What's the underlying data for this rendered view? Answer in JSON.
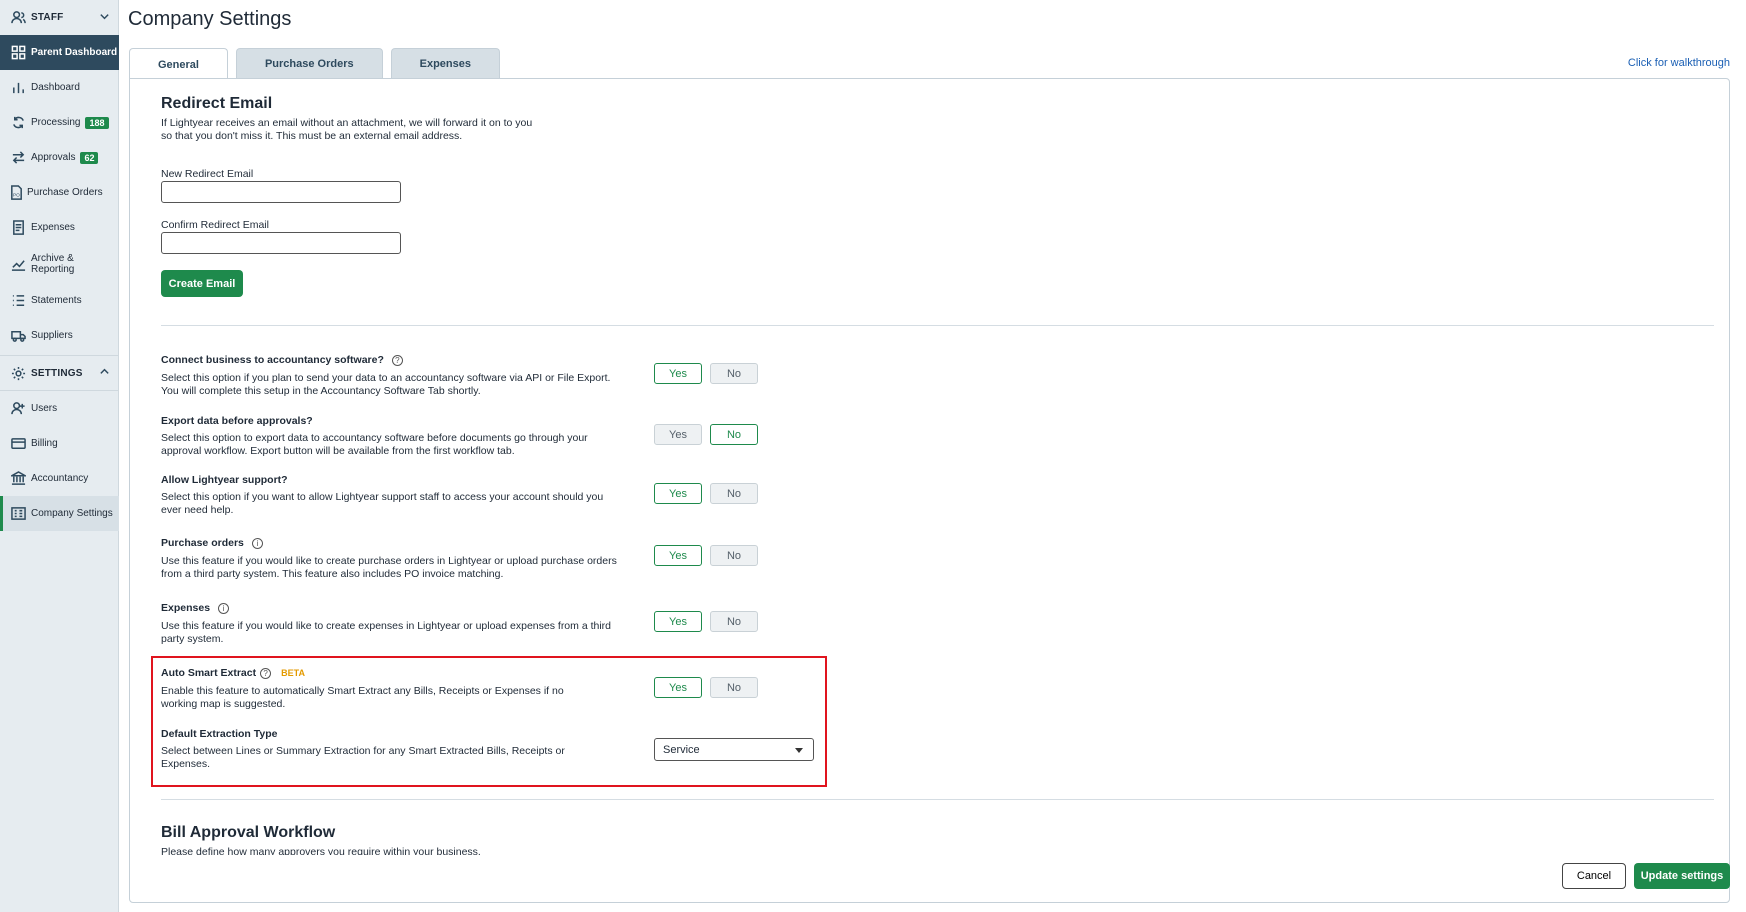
{
  "sidebar": {
    "staff_section": "STAFF",
    "settings_section": "SETTINGS",
    "items": [
      {
        "label": "Parent Dashboard"
      },
      {
        "label": "Dashboard"
      },
      {
        "label": "Processing",
        "badge": "188"
      },
      {
        "label": "Approvals",
        "badge": "62"
      },
      {
        "label": "Purchase Orders"
      },
      {
        "label": "Expenses"
      },
      {
        "label": "Archive &",
        "label2": "Reporting"
      },
      {
        "label": "Statements"
      },
      {
        "label": "Suppliers"
      }
    ],
    "settings_items": [
      {
        "label": "Users"
      },
      {
        "label": "Billing"
      },
      {
        "label": "Accountancy"
      },
      {
        "label": "Company Settings"
      }
    ]
  },
  "page": {
    "title": "Company Settings",
    "tabs": [
      {
        "label": "General"
      },
      {
        "label": "Purchase Orders"
      },
      {
        "label": "Expenses"
      }
    ],
    "walkthrough": "Click for walkthrough"
  },
  "redirect": {
    "heading": "Redirect Email",
    "desc1": "If Lightyear receives an email without an attachment, we will forward it on to you",
    "desc2": "so that you don't miss it. This must be an external email address.",
    "new_label": "New Redirect Email",
    "confirm_label": "Confirm Redirect Email",
    "create_button": "Create Email"
  },
  "options": [
    {
      "title": "Connect business to accountancy software?",
      "desc": "Select this option if you plan to send your data to an accountancy software via API or File Export. You will complete this setup in the Accountancy Software Tab shortly.",
      "selected": "Yes"
    },
    {
      "title": "Export data before approvals?",
      "desc": "Select this option to export data to accountancy software before documents go through your approval workflow. Export button will be available from the first workflow tab.",
      "selected": "No"
    },
    {
      "title": "Allow Lightyear support?",
      "desc": "Select this option if you want to allow Lightyear support staff to access your account should you ever need help.",
      "selected": "Yes"
    },
    {
      "title": "Purchase orders",
      "desc": "Use this feature if you would like to create purchase orders in Lightyear or upload purchase orders from a third party system. This feature also includes PO invoice matching.",
      "selected": "Yes"
    },
    {
      "title": "Expenses",
      "desc": "Use this feature if you would like to create expenses in Lightyear or upload expenses from a third party system.",
      "selected": "Yes"
    },
    {
      "title": "Auto Smart Extract",
      "badge": "BETA",
      "desc": "Enable this feature to automatically Smart Extract any Bills, Receipts or Expenses if no working map is suggested.",
      "selected": "Yes"
    }
  ],
  "yes_label": "Yes",
  "no_label": "No",
  "extraction": {
    "title": "Default Extraction Type",
    "desc": "Select between Lines or Summary Extraction for any Smart Extracted Bills, Receipts or Expenses.",
    "value": "Service"
  },
  "workflow": {
    "heading": "Bill Approval Workflow",
    "desc": "Please define how many approvers you require within your business."
  },
  "footer": {
    "cancel": "Cancel",
    "update": "Update settings"
  }
}
